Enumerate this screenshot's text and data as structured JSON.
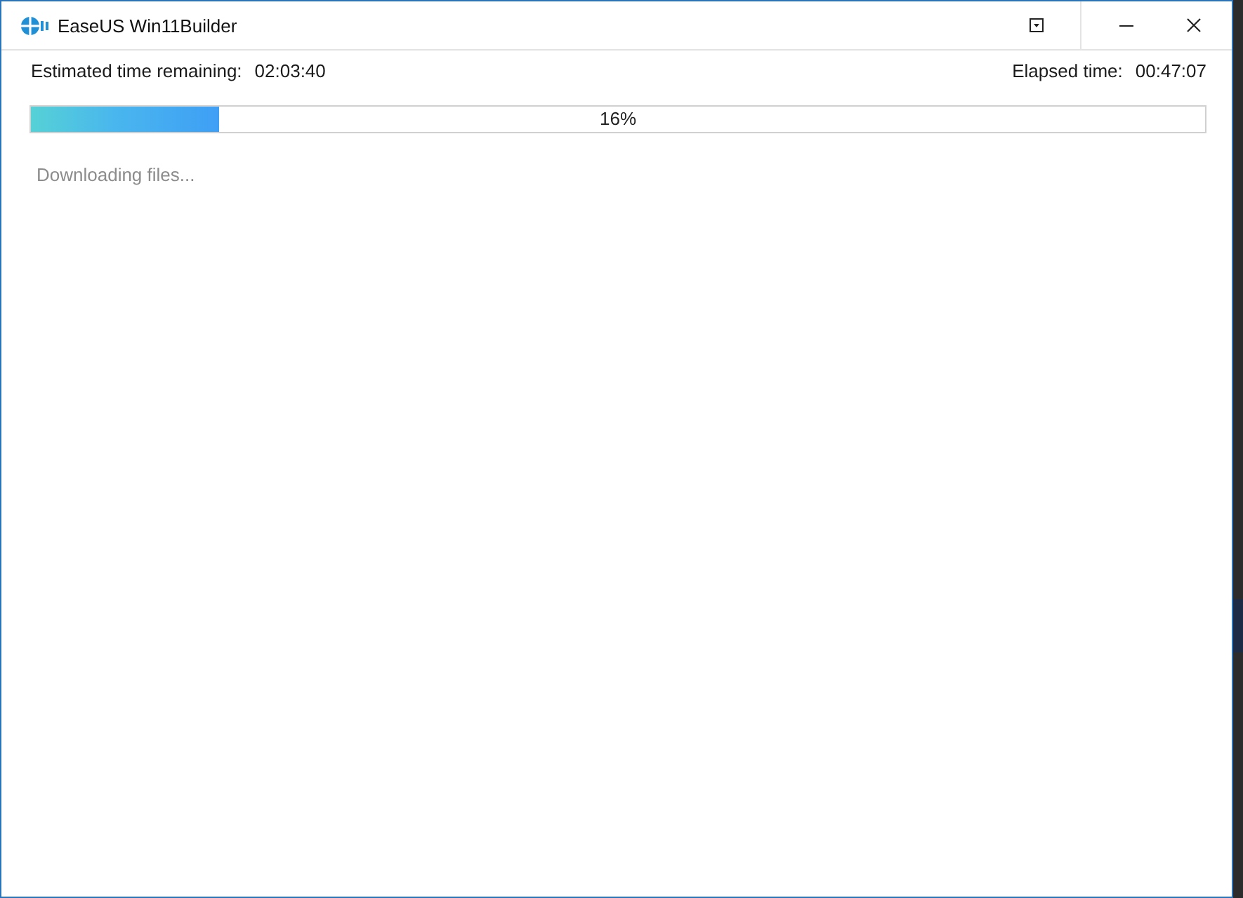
{
  "window": {
    "title": "EaseUS Win11Builder"
  },
  "progress": {
    "remaining_label": "Estimated time remaining:",
    "remaining_value": "02:03:40",
    "elapsed_label": "Elapsed time:",
    "elapsed_value": "00:47:07",
    "level": 0.16,
    "percent": "16%",
    "status": "Downloading files..."
  }
}
